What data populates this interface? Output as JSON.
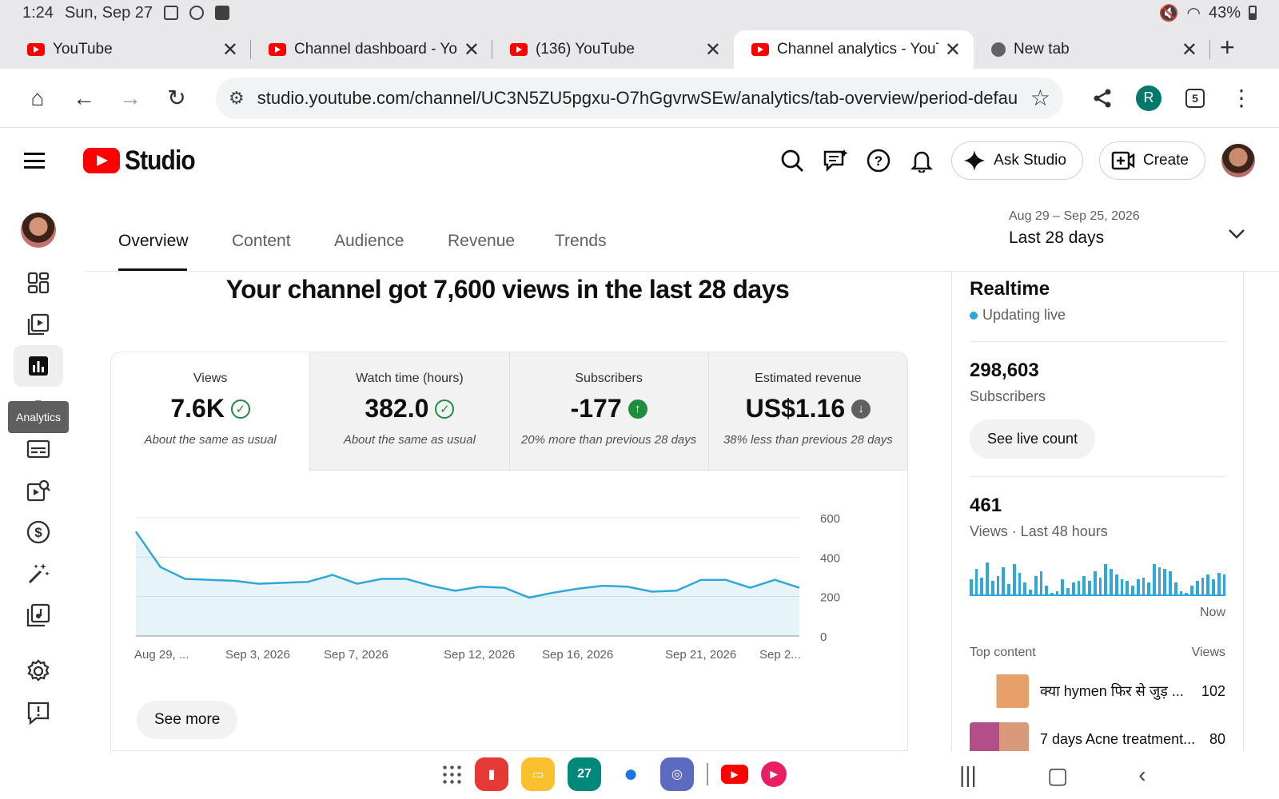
{
  "status": {
    "time": "1:24",
    "date": "Sun, Sep 27",
    "battery": "43%"
  },
  "tabs": [
    {
      "title": "YouTube",
      "active": false
    },
    {
      "title": "Channel dashboard - YouT",
      "active": false
    },
    {
      "title": "(136) YouTube",
      "active": false
    },
    {
      "title": "Channel analytics - YouTub",
      "active": true
    },
    {
      "title": "New tab",
      "active": false
    }
  ],
  "toolbar": {
    "url": "studio.youtube.com/channel/UC3N5ZU5pgxu-O7hGgvrwSEw/analytics/tab-overview/period-defau",
    "avatar_letter": "R",
    "tab_count": "5"
  },
  "header": {
    "logo_text": "Studio",
    "ask_label": "Ask Studio",
    "create_label": "Create"
  },
  "sidebar": {
    "tooltip": "Analytics"
  },
  "analytics_tabs": [
    "Overview",
    "Content",
    "Audience",
    "Revenue",
    "Trends"
  ],
  "date_range": {
    "range": "Aug 29 – Sep 25, 2026",
    "label": "Last 28 days"
  },
  "headline": "Your channel got 7,600 views in the last 28 days",
  "metrics": [
    {
      "label": "Views",
      "value": "7.6K",
      "compare": "About the same as usual",
      "status": "check"
    },
    {
      "label": "Watch time (hours)",
      "value": "382.0",
      "compare": "About the same as usual",
      "status": "check"
    },
    {
      "label": "Subscribers",
      "value": "-177",
      "compare": "20% more than previous 28 days",
      "status": "up"
    },
    {
      "label": "Estimated revenue",
      "value": "US$1.16",
      "compare": "38% less than previous 28 days",
      "status": "down"
    }
  ],
  "chart_data": {
    "type": "area",
    "x_tick_labels": [
      "Aug 29, ...",
      "Sep 3, 2026",
      "Sep 7, 2026",
      "Sep 12, 2026",
      "Sep 16, 2026",
      "Sep 21, 2026",
      "Sep 2..."
    ],
    "y_tick_labels": [
      "600",
      "400",
      "200",
      "0"
    ],
    "ylim": [
      0,
      600
    ],
    "values": [
      530,
      350,
      290,
      285,
      280,
      265,
      270,
      275,
      310,
      265,
      290,
      290,
      255,
      230,
      250,
      245,
      195,
      220,
      240,
      255,
      250,
      225,
      230,
      285,
      285,
      245,
      285,
      245
    ],
    "color": "#2ea8d8"
  },
  "see_more_label": "See more",
  "realtime": {
    "title": "Realtime",
    "live_label": "Updating live",
    "subscribers": "298,603",
    "subscribers_label": "Subscribers",
    "live_count_btn": "See live count",
    "views": "461",
    "views_label": "Views · Last 48 hours",
    "now_label": "Now",
    "bar_levels": [
      0.45,
      0.75,
      0.5,
      0.95,
      0.4,
      0.55,
      0.8,
      0.3,
      0.9,
      0.65,
      0.35,
      0.15,
      0.55,
      0.7,
      0.25,
      0.05,
      0.1,
      0.45,
      0.2,
      0.35,
      0.4,
      0.55,
      0.4,
      0.7,
      0.5,
      0.9,
      0.75,
      0.6,
      0.45,
      0.4,
      0.25,
      0.45,
      0.5,
      0.35,
      0.9,
      0.8,
      0.75,
      0.7,
      0.35,
      0.1,
      0.05,
      0.25,
      0.4,
      0.5,
      0.6,
      0.45,
      0.65,
      0.6
    ],
    "top_content_label": "Top content",
    "views_col_label": "Views",
    "top_content": [
      {
        "title": "क्या hymen फिर से जुड़ ...",
        "views": "102"
      },
      {
        "title": "7 days Acne treatment...",
        "views": "80"
      }
    ]
  }
}
